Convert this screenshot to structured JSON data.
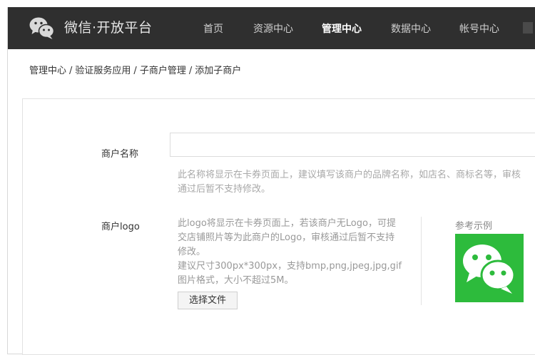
{
  "header": {
    "brand": "微信·开放平台",
    "nav": [
      {
        "label": "首页",
        "active": false
      },
      {
        "label": "资源中心",
        "active": false
      },
      {
        "label": "管理中心",
        "active": true
      },
      {
        "label": "数据中心",
        "active": false
      },
      {
        "label": "帐号中心",
        "active": false
      }
    ],
    "colors": {
      "bar": "#2f2f2f",
      "active_text": "#ffffff",
      "text": "#d0d0d0"
    }
  },
  "breadcrumb": {
    "items": [
      "管理中心",
      "验证服务应用",
      "子商户管理",
      "添加子商户"
    ],
    "separator": "/"
  },
  "form": {
    "name_label": "商户名称",
    "name_value": "",
    "name_hint_line1": "此名称将显示在卡券页面上，建议填写该商户的品牌名称，如店名、商标名等，审核",
    "name_hint_line2": "通过后暂不支持修改。",
    "logo_label": "商户logo",
    "logo_desc_lines": [
      "此logo将显示在卡券页面上，若该商户无Logo，可提",
      "交店铺照片等为此商户的Logo，审核通过后暂不支持",
      "修改。",
      "建议尺寸300px*300px，支持bmp,png,jpeg,jpg,gif",
      "图片格式，大小不超过5M。"
    ],
    "file_button": "选择文件",
    "example_label": "参考示例",
    "example_icon": "wechat-logo-icon",
    "example_bg": "#2dbb3c"
  }
}
